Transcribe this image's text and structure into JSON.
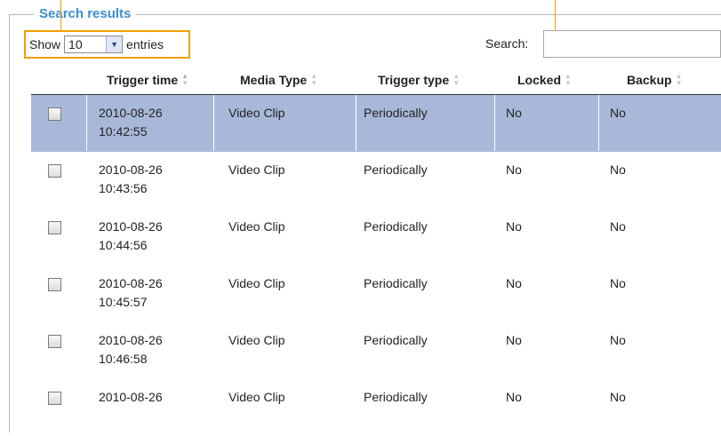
{
  "panel": {
    "legend": "Search results"
  },
  "controls": {
    "show_label": "Show",
    "entries_value": "10",
    "entries_label": "entries",
    "search_label": "Search:",
    "search_value": ""
  },
  "table": {
    "columns": [
      "Trigger time",
      "Media Type",
      "Trigger type",
      "Locked",
      "Backup"
    ],
    "rows": [
      {
        "date": "2010-08-26",
        "time": "10:42:55",
        "media": "Video Clip",
        "trigger": "Periodically",
        "locked": "No",
        "backup": "No",
        "selected": true
      },
      {
        "date": "2010-08-26",
        "time": "10:43:56",
        "media": "Video Clip",
        "trigger": "Periodically",
        "locked": "No",
        "backup": "No",
        "selected": false
      },
      {
        "date": "2010-08-26",
        "time": "10:44:56",
        "media": "Video Clip",
        "trigger": "Periodically",
        "locked": "No",
        "backup": "No",
        "selected": false
      },
      {
        "date": "2010-08-26",
        "time": "10:45:57",
        "media": "Video Clip",
        "trigger": "Periodically",
        "locked": "No",
        "backup": "No",
        "selected": false
      },
      {
        "date": "2010-08-26",
        "time": "10:46:58",
        "media": "Video Clip",
        "trigger": "Periodically",
        "locked": "No",
        "backup": "No",
        "selected": false
      },
      {
        "date": "2010-08-26",
        "time": "",
        "media": "Video Clip",
        "trigger": "Periodically",
        "locked": "No",
        "backup": "No",
        "selected": false
      }
    ]
  },
  "colors": {
    "legend": "#3a8fd0",
    "selected_row": "#a8b8d8",
    "callout": "#f0a000"
  }
}
